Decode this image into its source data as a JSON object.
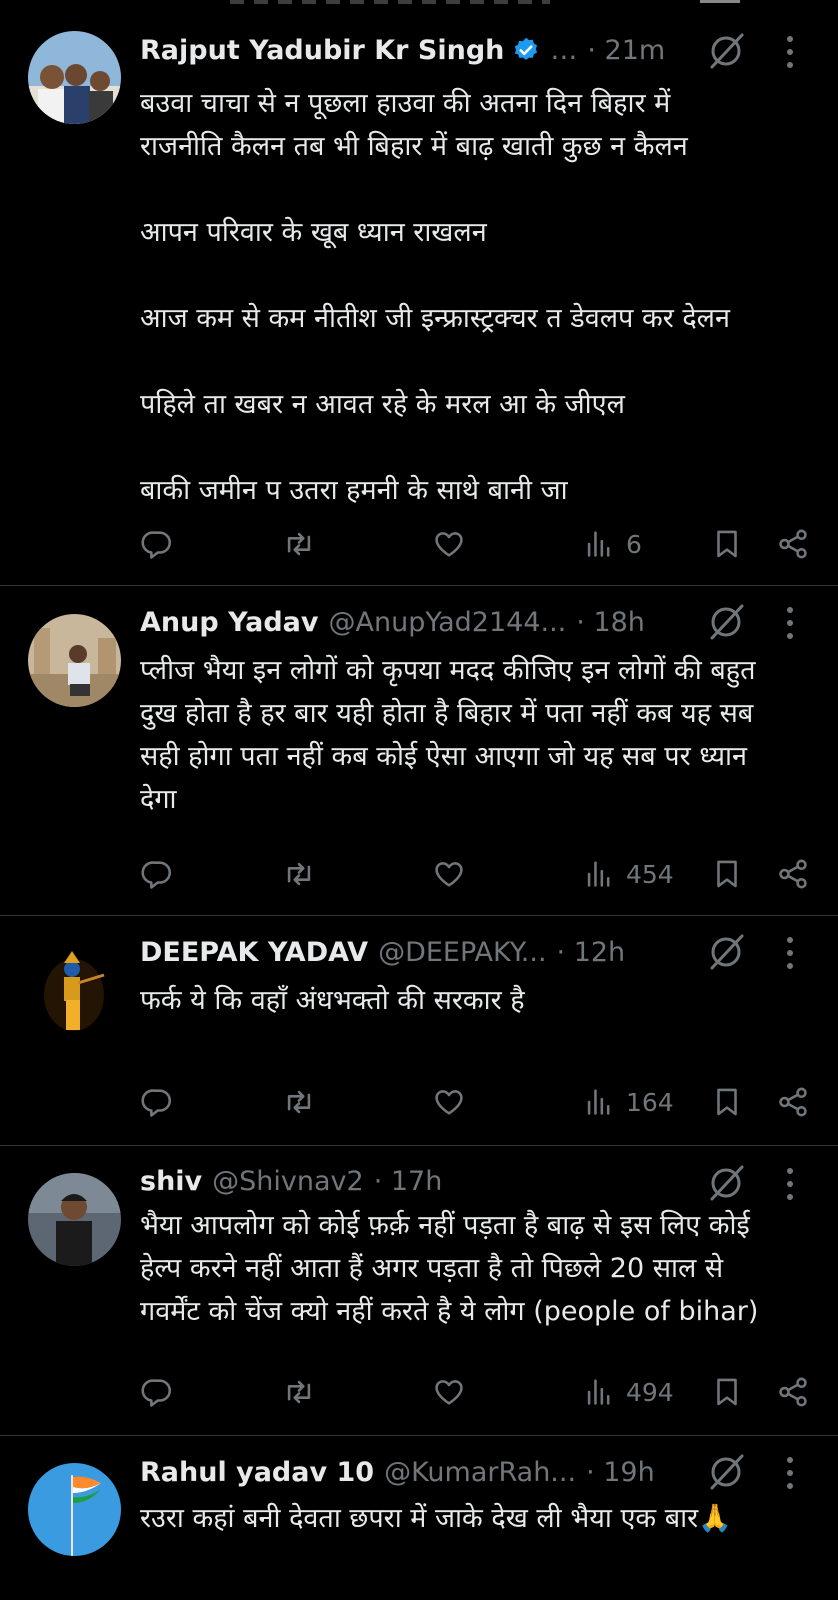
{
  "colors": {
    "background": "#000000",
    "text": "#e7e9ea",
    "secondary": "#71767b",
    "verified": "#1d9bf0",
    "divider": "#2f3336"
  },
  "icons": {
    "reply": "reply-icon",
    "retweet": "retweet-icon",
    "like": "heart-icon",
    "views": "views-icon",
    "bookmark": "bookmark-icon",
    "share": "share-icon",
    "grok": "grok-icon",
    "more": "more-vertical-icon",
    "verified": "verified-badge-icon"
  },
  "tweets": [
    {
      "name": "Rajput Yadubir Kr Singh",
      "verified": true,
      "handle": "…",
      "time": "· 21m",
      "text": "बउवा चाचा से न पूछला हाउवा की अतना दिन बिहार में\nराजनीति कैलन तब भी बिहार में बाढ़ खाती कुछ न कैलन\n\nआपन परिवार के खूब ध्यान राखलन\n\nआज कम से कम नीतीश जी इन्फ्रास्ट्रक्चर त डेवलप कर देलन\n\nपहिले ता खबर न आवत रहे के मरल आ के जीएल\n\nबाकी जमीन प उतरा हमनी के साथे बानी जा",
      "views": "6"
    },
    {
      "name": "Anup Yadav",
      "verified": false,
      "handle": "@AnupYad2144...",
      "time": "· 18h",
      "text": "प्लीज भैया इन लोगों को कृपया मदद कीजिए इन लोगों की बहुत\nदुख होता है हर बार यही होता है बिहार में पता नहीं कब यह सब\nसही होगा पता नहीं कब कोई ऐसा आएगा जो यह सब पर ध्यान\nदेगा",
      "views": "454"
    },
    {
      "name": "DEEPAK YADAV",
      "verified": false,
      "handle": "@DEEPAKY...",
      "time": "· 12h",
      "text": "फर्क ये कि वहाँ अंधभक्तो की सरकार है",
      "views": "164"
    },
    {
      "name": "shiv",
      "verified": false,
      "handle": "@Shivnav2",
      "time": "· 17h",
      "text": "भैया आपलोग को कोई फ़र्क़ नहीं पड़ता है बाढ़ से इस लिए कोई\nहेल्प करने नहीं आता हैं अगर पड़ता है तो पिछले 20 साल से\nगवर्मेंट को चेंज क्यो नहीं करते है ये लोग (people of bihar)",
      "views": "494"
    },
    {
      "name": "Rahul yadav 10",
      "verified": false,
      "handle": "@KumarRah...",
      "time": "· 19h",
      "text": "रउरा कहां बनी देवता छपरा में जाके देख ली भैया एक बार🙏"
    }
  ]
}
